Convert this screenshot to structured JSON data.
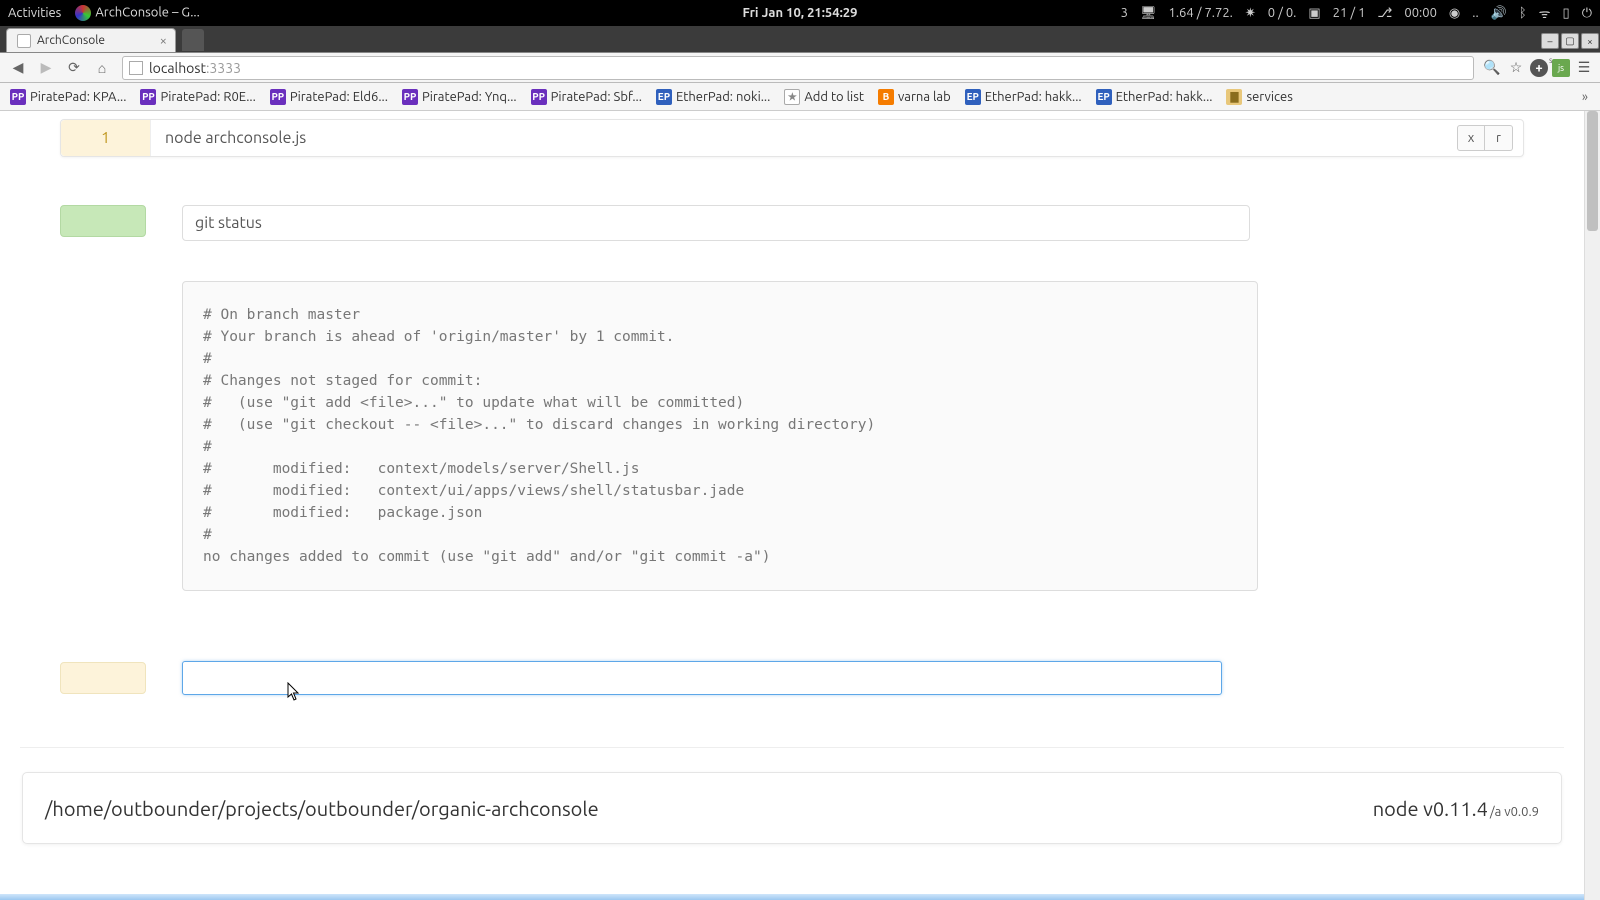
{
  "gnome": {
    "activities": "Activities",
    "app_title": "ArchConsole – G...",
    "clock": "Fri Jan 10, 21:54:29",
    "ws": "3",
    "load": "1.64 / 7.72.",
    "net": "0 / 0.",
    "cpu": "21 / 1",
    "time2": "00:00",
    "dots": ".."
  },
  "browser": {
    "tab_title": "ArchConsole",
    "url_host": "localhost",
    "url_port": ":3333"
  },
  "bookmarks": [
    {
      "icon": "pp",
      "label": "PiratePad: KPA..."
    },
    {
      "icon": "pp",
      "label": "PiratePad: R0E..."
    },
    {
      "icon": "pp",
      "label": "PiratePad: Eld6..."
    },
    {
      "icon": "pp",
      "label": "PiratePad: Ynq..."
    },
    {
      "icon": "pp",
      "label": "PiratePad: Sbf..."
    },
    {
      "icon": "ep",
      "label": "EtherPad: noki..."
    },
    {
      "icon": "st",
      "label": "Add to list"
    },
    {
      "icon": "bl",
      "label": "varna lab"
    },
    {
      "icon": "ep",
      "label": "EtherPad: hakk..."
    },
    {
      "icon": "ep",
      "label": "EtherPad: hakk..."
    },
    {
      "icon": "fd",
      "label": "services"
    }
  ],
  "block1": {
    "index": "1",
    "command": "node archconsole.js",
    "btn_x": "x",
    "btn_r": "r"
  },
  "block2": {
    "command": "git status",
    "output": "# On branch master\n# Your branch is ahead of 'origin/master' by 1 commit.\n#\n# Changes not staged for commit:\n#   (use \"git add <file>...\" to update what will be committed)\n#   (use \"git checkout -- <file>...\" to discard changes in working directory)\n#\n#       modified:   context/models/server/Shell.js\n#       modified:   context/ui/apps/views/shell/statusbar.jade\n#       modified:   package.json\n#\nno changes added to commit (use \"git add\" and/or \"git commit -a\")"
  },
  "block3": {
    "input_value": ""
  },
  "status": {
    "cwd": "/home/outbounder/projects/outbounder/organic-archconsole",
    "node_ver": "node v0.11.4",
    "app_ver": "/a v0.0.9"
  }
}
